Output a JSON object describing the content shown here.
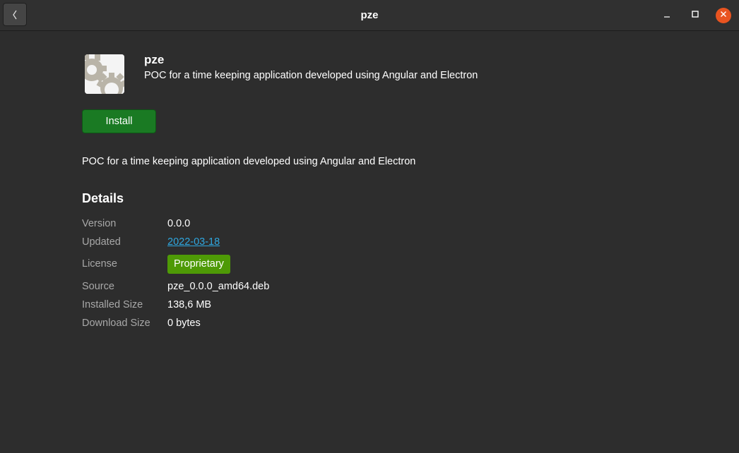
{
  "window": {
    "title": "pze"
  },
  "app": {
    "name": "pze",
    "summary": "POC for a time keeping application developed using Angular and Electron",
    "icon": "gear-icon",
    "install_label": "Install",
    "description": "POC for a time keeping application developed using Angular and Electron"
  },
  "details": {
    "heading": "Details",
    "rows": [
      {
        "label": "Version",
        "value": "0.0.0"
      },
      {
        "label": "Updated",
        "value": "2022-03-18"
      },
      {
        "label": "License",
        "value": "Proprietary"
      },
      {
        "label": "Source",
        "value": "pze_0.0.0_amd64.deb"
      },
      {
        "label": "Installed Size",
        "value": "138,6 MB"
      },
      {
        "label": "Download Size",
        "value": "0 bytes"
      }
    ]
  },
  "colors": {
    "install_button": "#1a7a23",
    "license_badge": "#4e9a06",
    "link": "#2ea7e0",
    "close_button": "#e95420"
  }
}
